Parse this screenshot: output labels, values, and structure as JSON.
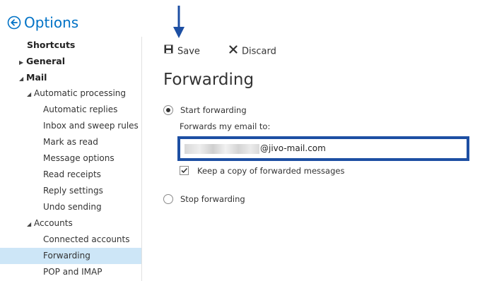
{
  "header": {
    "title": "Options"
  },
  "sidebar": {
    "items": [
      {
        "label": "Shortcuts"
      },
      {
        "label": "General"
      },
      {
        "label": "Mail"
      },
      {
        "label": "Automatic processing"
      },
      {
        "label": "Automatic replies"
      },
      {
        "label": "Inbox and sweep rules"
      },
      {
        "label": "Mark as read"
      },
      {
        "label": "Message options"
      },
      {
        "label": "Read receipts"
      },
      {
        "label": "Reply settings"
      },
      {
        "label": "Undo sending"
      },
      {
        "label": "Accounts"
      },
      {
        "label": "Connected accounts"
      },
      {
        "label": "Forwarding"
      },
      {
        "label": "POP and IMAP"
      }
    ],
    "selected": "Forwarding"
  },
  "toolbar": {
    "save_label": "Save",
    "discard_label": "Discard"
  },
  "main": {
    "title": "Forwarding",
    "start_forwarding_label": "Start forwarding",
    "start_forwarding_selected": true,
    "forward_field_label": "Forwards my email to:",
    "email_visible_part": "@jivo-mail.com",
    "keep_copy_label": "Keep a copy of forwarded messages",
    "keep_copy_checked": true,
    "stop_forwarding_label": "Stop forwarding",
    "stop_forwarding_selected": false
  },
  "colors": {
    "accent": "#0072c6",
    "selected_bg": "#cde6f7",
    "highlight_border": "#1d4fa3",
    "annotation_arrow": "#1d4fa3"
  },
  "icons": [
    "back-arrow-icon",
    "expand-arrow-icon",
    "collapse-arrow-icon",
    "save-icon",
    "discard-x-icon",
    "checkmark-icon",
    "annotation-down-arrow-icon"
  ]
}
